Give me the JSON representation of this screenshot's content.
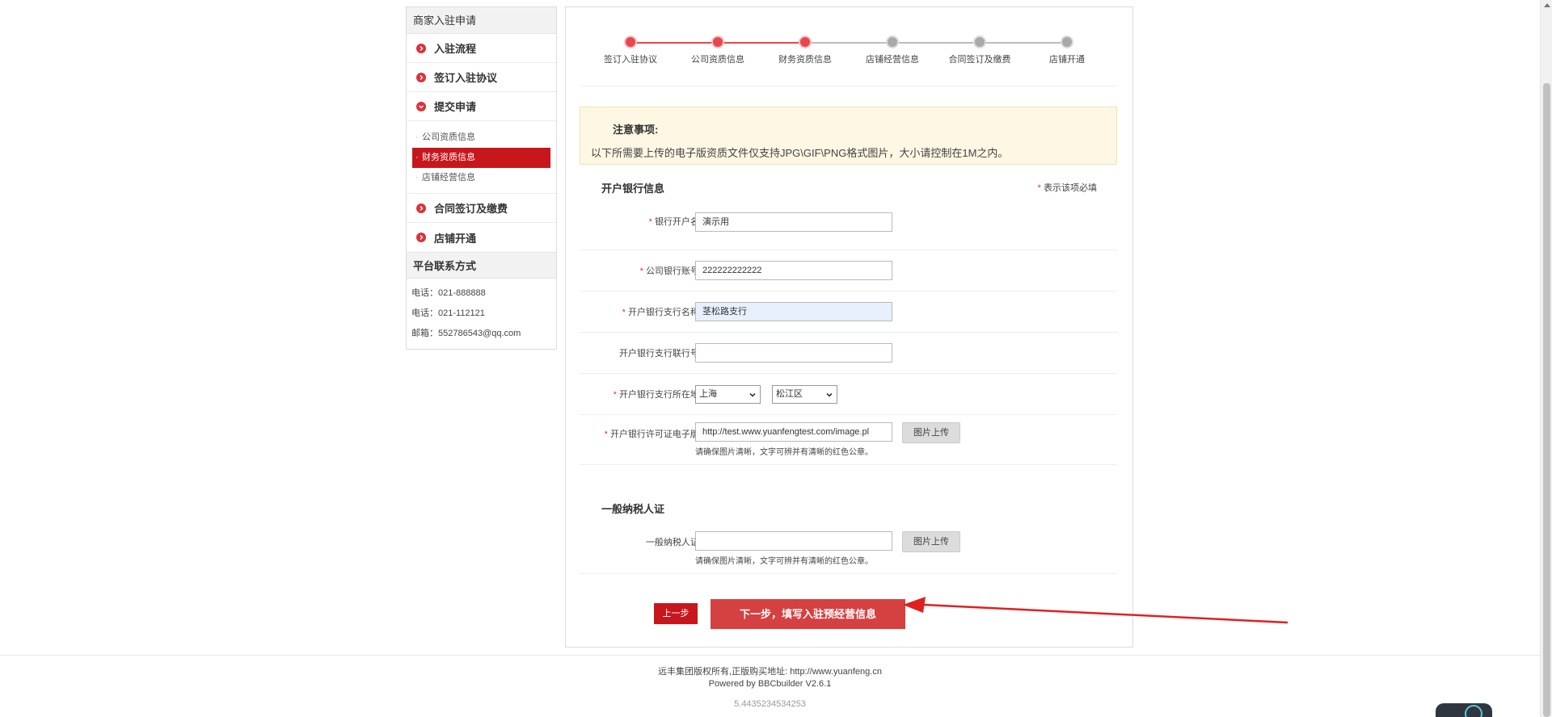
{
  "sidebar": {
    "title": "商家入驻申请",
    "items": [
      {
        "label": "入驻流程"
      },
      {
        "label": "签订入驻协议"
      },
      {
        "label": "提交申请"
      }
    ],
    "subitems": [
      {
        "label": "公司资质信息",
        "active": false
      },
      {
        "label": "财务资质信息",
        "active": true
      },
      {
        "label": "店铺经营信息",
        "active": false
      }
    ],
    "items_after": [
      {
        "label": "合同签订及缴费"
      },
      {
        "label": "店铺开通"
      }
    ],
    "contact_title": "平台联系方式",
    "contacts": [
      "电话：021-888888",
      "电话：021-112121",
      "邮箱：552786543@qq.com"
    ]
  },
  "steps": [
    {
      "label": "签订入驻协议",
      "done": true
    },
    {
      "label": "公司资质信息",
      "done": true
    },
    {
      "label": "财务资质信息",
      "done": true
    },
    {
      "label": "店铺经营信息",
      "done": false
    },
    {
      "label": "合同签订及缴费",
      "done": false
    },
    {
      "label": "店铺开通",
      "done": false
    }
  ],
  "notice": {
    "title": "注意事项:",
    "content": "以下所需要上传的电子版资质文件仅支持JPG\\GIF\\PNG格式图片，大小请控制在1M之内。"
  },
  "bank_section": {
    "title": "开户银行信息",
    "required_note": "表示该项必填",
    "required_mark": "*",
    "fields": {
      "account_name": {
        "label": "银行开户名:",
        "value": "演示用"
      },
      "account_number": {
        "label": "公司银行账号:",
        "value": "222222222222"
      },
      "branch_name": {
        "label": "开户银行支行名称:",
        "value": "茎松路支行"
      },
      "branch_code": {
        "label": "开户银行支行联行号:",
        "value": ""
      },
      "branch_location": {
        "label": "开户银行支行所在地:",
        "province": "上海",
        "district": "松江区"
      },
      "license": {
        "label": "开户银行许可证电子版:",
        "value": "http://test.www.yuanfengtest.com/image.pl",
        "upload_label": "图片上传",
        "hint": "请确保图片清晰，文字可辨并有清晰的红色公章。"
      }
    }
  },
  "tax_section": {
    "title": "一般纳税人证",
    "label": "一般纳税人证:",
    "value": "",
    "upload_label": "图片上传",
    "hint": "请确保图片清晰，文字可辨并有清晰的红色公章。"
  },
  "buttons": {
    "prev": "上一步",
    "next": "下一步，填写入驻预经营信息"
  },
  "footer": {
    "copyright": "远丰集团版权所有,正版购买地址:  http://www.yuanfeng.cn",
    "powered": "Powered by BBCbuilder V2.6.1",
    "version": "5.4435234534253"
  },
  "colors": {
    "accent": "#c8161d",
    "step_active": "#e8474e",
    "step_inactive": "#a9a9a9",
    "annotation_arrow": "#e02020"
  }
}
